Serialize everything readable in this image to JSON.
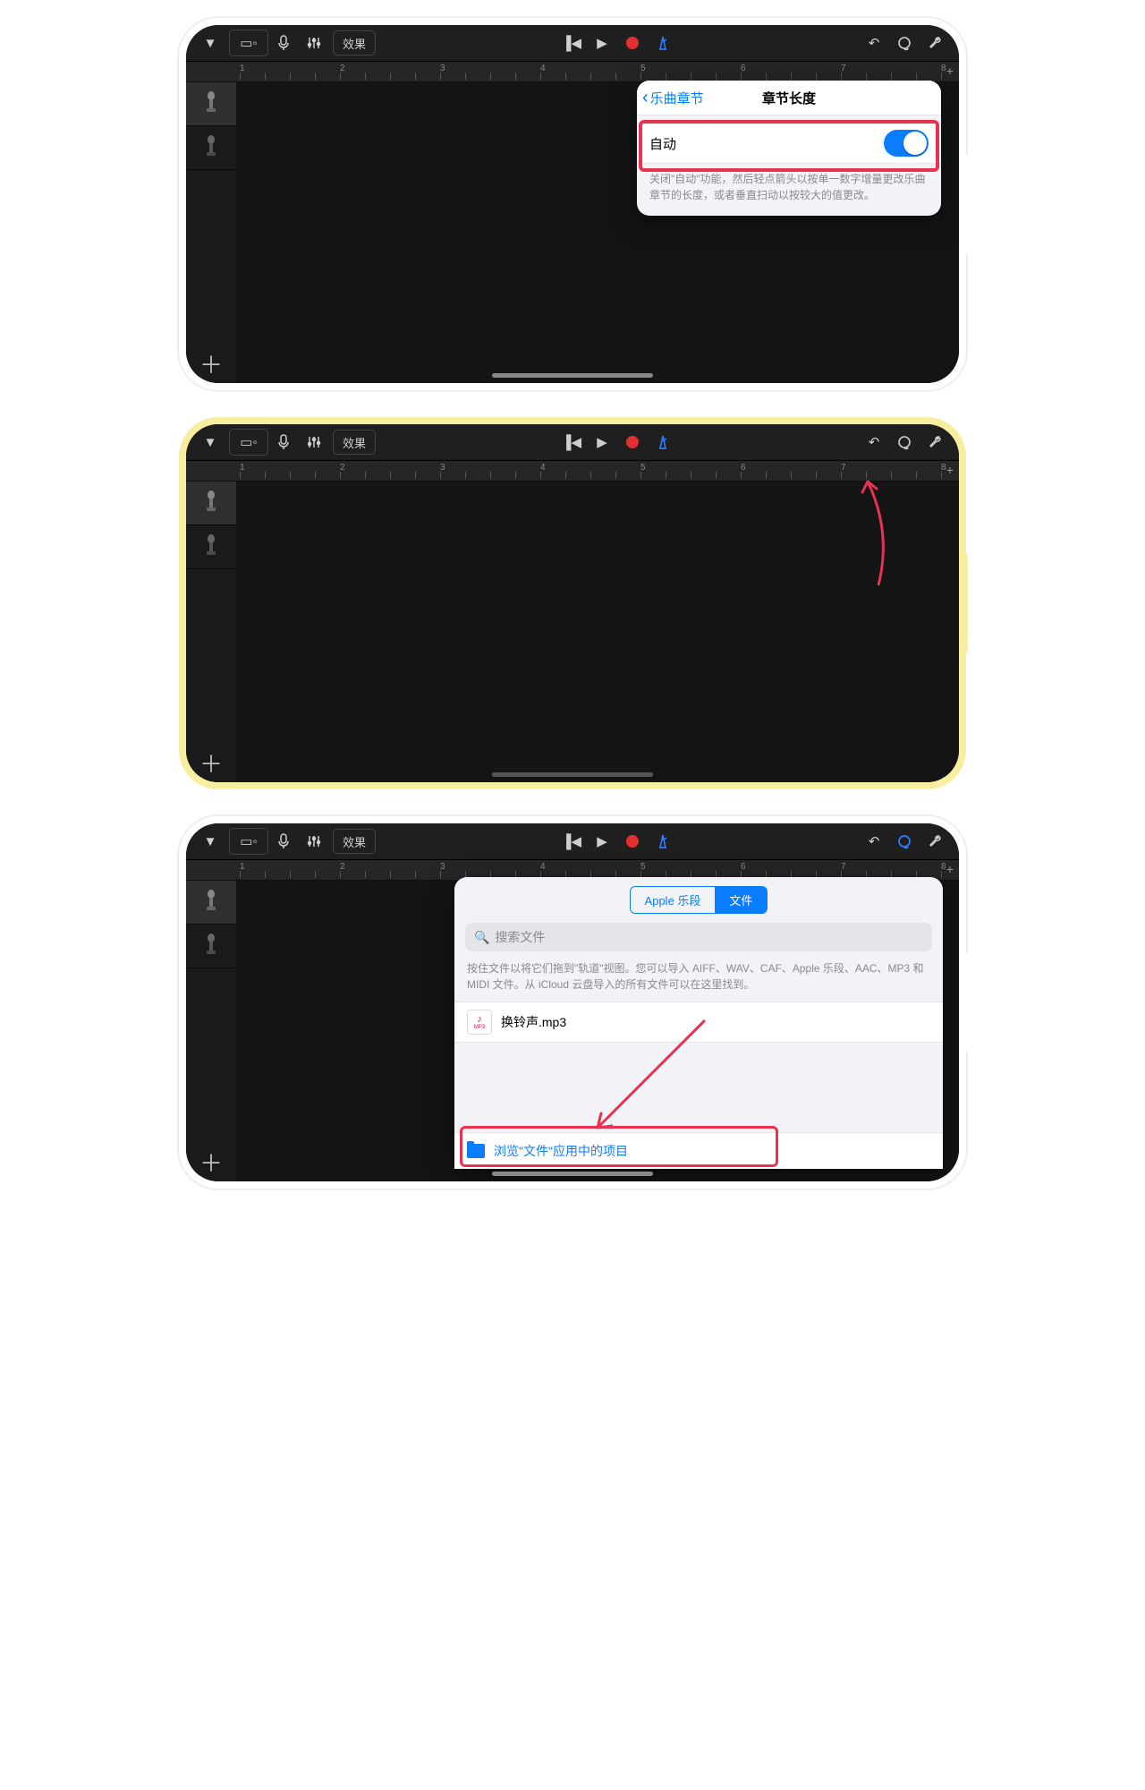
{
  "toolbar": {
    "fx_label": "效果"
  },
  "ruler_marks": [
    "1",
    "2",
    "3",
    "4",
    "5",
    "6",
    "7",
    "8"
  ],
  "panel1": {
    "back_label": "乐曲章节",
    "title": "章节长度",
    "auto_label": "自动",
    "hint": "关闭\"自动\"功能，然后轻点箭头以按单一数字增量更改乐曲章节的长度，或者垂直扫动以按较大的值更改。"
  },
  "panel3": {
    "seg_loops": "Apple 乐段",
    "seg_files": "文件",
    "search_placeholder": "搜索文件",
    "hint": "按住文件以将它们拖到\"轨道\"视图。您可以导入 AIFF、WAV、CAF、Apple 乐段、AAC、MP3 和 MIDI 文件。从 iCloud 云盘导入的所有文件可以在这里找到。",
    "file_name": "换铃声.mp3",
    "file_badge": "MP3",
    "browse_label": "浏览\"文件\"应用中的项目"
  }
}
